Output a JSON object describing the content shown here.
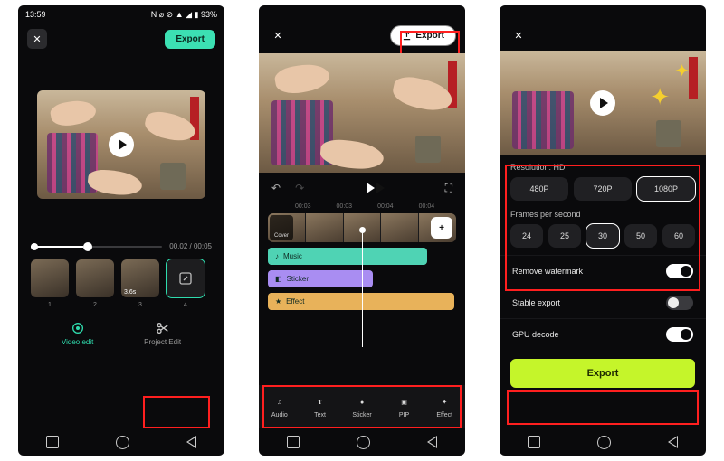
{
  "status": {
    "time": "13:59",
    "right": "N ⌀ ⊘ ▲ ◢ ▮ 93%"
  },
  "colors": {
    "accent_teal": "#2fdcae",
    "accent_export": "#3ce0b3",
    "accent_lime": "#c5f52a",
    "highlight": "#ff1f1f"
  },
  "screen1": {
    "export_label": "Export",
    "slider": {
      "current": "00.02",
      "total": "00:05"
    },
    "thumbs": [
      {
        "id": 1,
        "label": "1"
      },
      {
        "id": 2,
        "label": "2"
      },
      {
        "id": 3,
        "label": "3.6s",
        "sublabel": "3"
      },
      {
        "id": 4,
        "label": "4",
        "icon": "edit-icon",
        "selected": true
      }
    ],
    "tabs": {
      "video_edit": "Video edit",
      "project_edit": "Project Edit"
    }
  },
  "screen2": {
    "export_label": "Export",
    "timecodes": [
      "00:03",
      "00:03",
      "00:04",
      "00:04"
    ],
    "cover_label": "Cover",
    "tracks": {
      "music": "Music",
      "sticker": "Sticker",
      "effect": "Effect"
    },
    "tools": [
      {
        "name": "audio",
        "label": "Audio"
      },
      {
        "name": "text",
        "label": "Text"
      },
      {
        "name": "sticker",
        "label": "Sticker"
      },
      {
        "name": "pip",
        "label": "PIP"
      },
      {
        "name": "effect",
        "label": "Effect"
      }
    ]
  },
  "screen3": {
    "resolution": {
      "title": "Resolution: HD",
      "options": [
        "480P",
        "720P",
        "1080P"
      ],
      "selected": "1080P"
    },
    "fps": {
      "title": "Frames per second",
      "options": [
        "24",
        "25",
        "30",
        "50",
        "60"
      ],
      "selected": "30"
    },
    "toggles": {
      "remove_watermark": {
        "label": "Remove watermark",
        "on": true
      },
      "stable_export": {
        "label": "Stable export",
        "on": false
      },
      "gpu_decode": {
        "label": "GPU decode",
        "on": true
      }
    },
    "export_label": "Export"
  }
}
